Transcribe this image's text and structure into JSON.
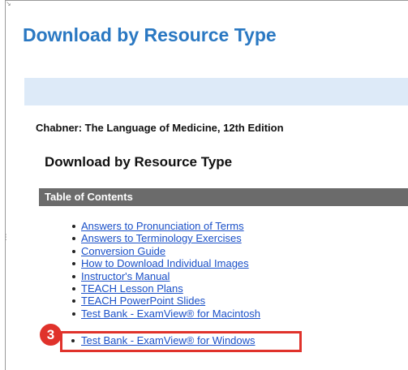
{
  "page": {
    "title": "Download by Resource Type"
  },
  "book": {
    "title": "Chabner: The Language of Medicine, 12th Edition"
  },
  "section": {
    "heading": "Download by Resource Type",
    "toc_label": "Table of Contents"
  },
  "resources": [
    "Answers to Pronunciation of Terms",
    "Answers to Terminology Exercises",
    "Conversion Guide",
    "How to Download Individual Images",
    "Instructor's Manual",
    "TEACH Lesson Plans",
    "TEACH PowerPoint Slides",
    "Test Bank - ExamView® for Macintosh"
  ],
  "highlighted": {
    "step_number": "3",
    "label": "Test Bank - ExamView® for Windows",
    "color": "#e0322b"
  },
  "colors": {
    "title_blue": "#2a78c2",
    "band_blue": "#ddeaf8",
    "toc_bar": "#6b6b6b",
    "link": "#1a50c8"
  }
}
